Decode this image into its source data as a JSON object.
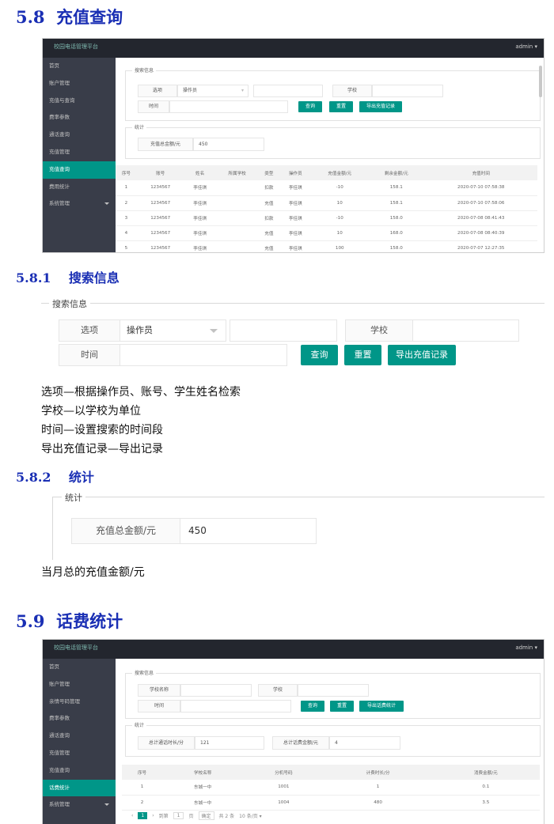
{
  "sec58": {
    "num": "5.8",
    "title": "充值查询"
  },
  "shot1": {
    "app_title": "校园电话管理平台",
    "user": "admin",
    "menu": [
      "首页",
      "账户管理",
      "充值与查询",
      "费率参数",
      "通话查询",
      "充值管理",
      "充值查询",
      "费用统计",
      "系统管理"
    ],
    "search_legend": "搜索信息",
    "option_label": "选项",
    "option_value": "操作员",
    "school_label": "学校",
    "time_label": "时间",
    "btn_query": "查询",
    "btn_reset": "重置",
    "btn_export": "导出充值记录",
    "stat_legend": "统计",
    "stat_label": "充值总金额/元",
    "stat_value": "450",
    "headers": [
      "序号",
      "账号",
      "姓名",
      "所属学校",
      "类型",
      "操作员",
      "充值金额/元",
      "剩余金额/元",
      "充值时间"
    ],
    "rows": [
      [
        "1",
        "1234567",
        "李佳琪",
        "",
        "扣款",
        "李佳琪",
        "-10",
        "158.1",
        "2020-07-10 07:58:38"
      ],
      [
        "2",
        "1234567",
        "李佳琪",
        "",
        "充值",
        "李佳琪",
        "10",
        "158.1",
        "2020-07-10 07:58:06"
      ],
      [
        "3",
        "1234567",
        "李佳琪",
        "",
        "扣款",
        "李佳琪",
        "-10",
        "158.0",
        "2020-07-08 08:41:43"
      ],
      [
        "4",
        "1234567",
        "李佳琪",
        "",
        "充值",
        "李佳琪",
        "10",
        "168.0",
        "2020-07-08 08:40:39"
      ],
      [
        "5",
        "1234567",
        "李佳琪",
        "",
        "充值",
        "李佳琪",
        "100",
        "158.0",
        "2020-07-07 12:27:35"
      ]
    ]
  },
  "sec581": {
    "num": "5.8.1",
    "title": "搜索信息"
  },
  "form": {
    "legend": "搜索信息",
    "option_label": "选项",
    "option_value": "操作员",
    "school_label": "学校",
    "time_label": "时间",
    "btn_query": "查询",
    "btn_reset": "重置",
    "btn_export": "导出充值记录"
  },
  "desc581": [
    "选项—根据操作员、账号、学生姓名检索",
    "学校—以学校为单位",
    "时间—设置搜索的时间段",
    "导出充值记录—导出记录"
  ],
  "sec582": {
    "num": "5.8.2",
    "title": "统计"
  },
  "stat": {
    "legend": "统计",
    "label": "充值总金额/元",
    "value": "450"
  },
  "desc582": "当月总的充值金额/元",
  "sec59": {
    "num": "5.9",
    "title": "话费统计"
  },
  "shot2": {
    "app_title": "校园电话管理平台",
    "user": "admin",
    "menu": [
      "首页",
      "账户管理",
      "亲情号码管理",
      "费率参数",
      "通话查询",
      "充值管理",
      "充值查询",
      "话费统计",
      "系统管理"
    ],
    "search_legend": "搜索信息",
    "school_name_label": "学校名称",
    "school_label": "学校",
    "time_label": "时间",
    "btn_query": "查询",
    "btn_reset": "重置",
    "btn_export": "导出话费统计",
    "stat_legend": "统计",
    "stat1_label": "总计通话时长/分",
    "stat1_value": "121",
    "stat2_label": "总计话费金额/元",
    "stat2_value": "4",
    "headers": [
      "序号",
      "学校名称",
      "分机号码",
      "计费时长/分",
      "消费金额/元"
    ],
    "rows": [
      [
        "1",
        "东城一中",
        "1001",
        "1",
        "0.1"
      ],
      [
        "2",
        "东城一中",
        "1004",
        "480",
        "3.5"
      ]
    ],
    "pager": {
      "page": "1",
      "goto": "到第",
      "page_unit": "页",
      "confirm": "确定",
      "total": "共 2 条",
      "size": "10 条/页"
    }
  }
}
